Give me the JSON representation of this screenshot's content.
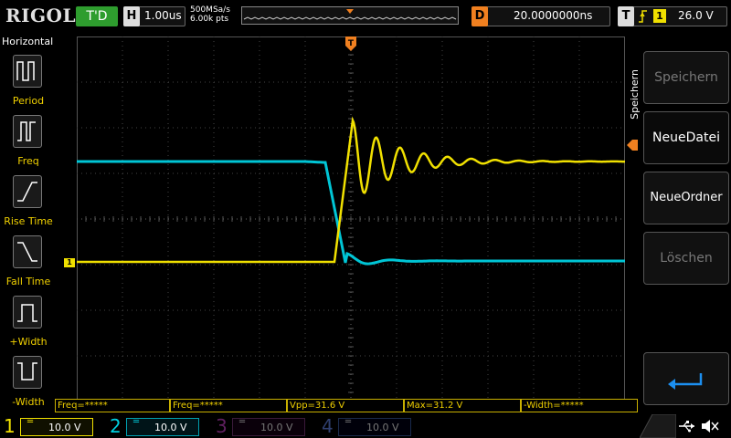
{
  "brand": "RIGOL",
  "run_status": "T'D",
  "timebase": {
    "key": "H",
    "value": "1.00us"
  },
  "sample": {
    "rate": "500MSa/s",
    "points": "6.00k pts"
  },
  "delay": {
    "key": "D",
    "value": "20.0000000ns"
  },
  "trigger": {
    "key": "T",
    "channel": "1",
    "level": "26.0 V"
  },
  "menu": {
    "title": "Horizontal",
    "items": [
      {
        "label": "Period"
      },
      {
        "label": "Freq"
      },
      {
        "label": "Rise Time"
      },
      {
        "label": "Fall Time"
      },
      {
        "label": "+Width"
      },
      {
        "label": "-Width"
      }
    ]
  },
  "measurements": [
    {
      "text": "Freq=*****"
    },
    {
      "text": "Freq=*****"
    },
    {
      "text": "Vpp=31.6 V"
    },
    {
      "text": "Max=31.2 V"
    },
    {
      "text": "-Width=*****"
    }
  ],
  "channels": [
    {
      "num": "1",
      "scale": "10.0 V",
      "color": "#f0e000",
      "active": true
    },
    {
      "num": "2",
      "scale": "10.0 V",
      "color": "#00d0e0",
      "active": true
    },
    {
      "num": "3",
      "scale": "10.0 V",
      "color": "#c000c0",
      "active": false
    },
    {
      "num": "4",
      "scale": "10.0 V",
      "color": "#2060ff",
      "active": false
    }
  ],
  "right_menu": {
    "title": "Speichern",
    "buttons": [
      {
        "label": "Speichern",
        "enabled": false
      },
      {
        "label": "NeueDatei",
        "enabled": true
      },
      {
        "label": "NeueOrdner",
        "enabled": true
      },
      {
        "label": "Löschen",
        "enabled": false
      }
    ],
    "enter_icon": "enter-arrow-icon"
  },
  "chart_data": {
    "type": "line",
    "grid": true,
    "divisions": {
      "x": 12,
      "y": 8
    },
    "series": [
      {
        "channel": "1",
        "color": "#f0e000",
        "behavior": "step up from ch1 marker level to trigger level with damped ringing"
      },
      {
        "channel": "2",
        "color": "#00d0e0",
        "behavior": "step down with small undershoot and settling"
      }
    ]
  },
  "usb_icon": "usb-icon",
  "speaker_icon": "speaker-muted-icon"
}
